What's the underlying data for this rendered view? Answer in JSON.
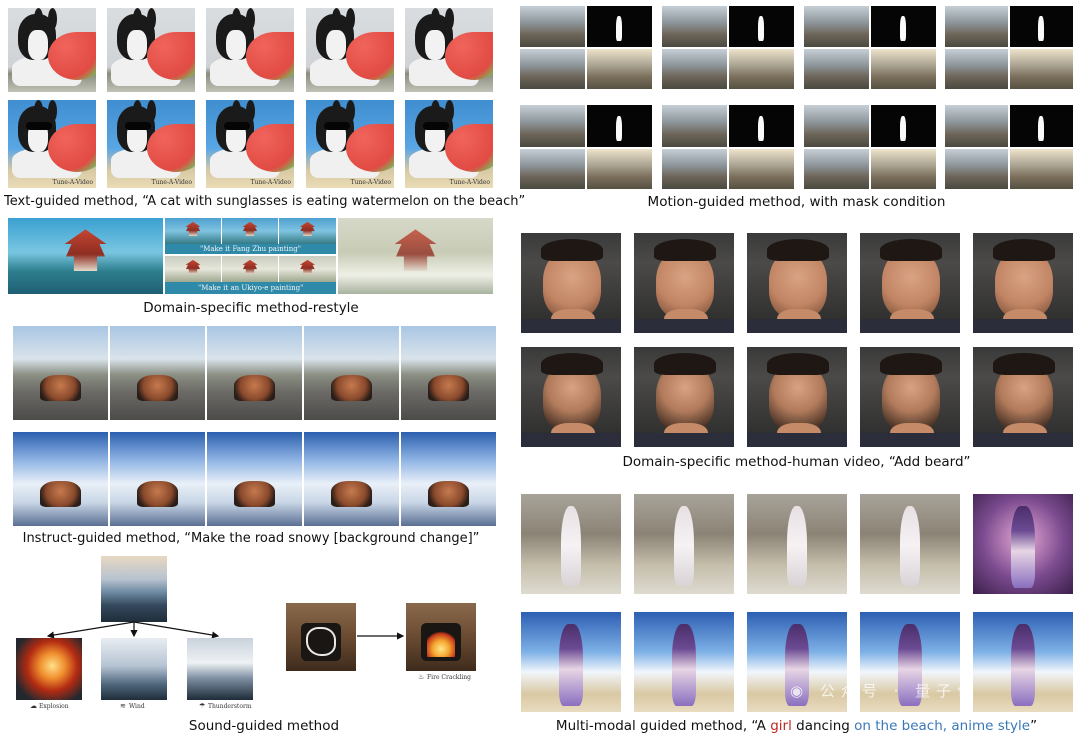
{
  "captions": {
    "text_guided": "Text-guided method, “A cat with sunglasses is eating watermelon on the beach”",
    "domain_restyle": "Domain-specific method-restyle",
    "instruct_guided": "Instruct-guided method, “Make the road snowy [background change]”",
    "sound_guided": "Sound-guided method",
    "motion_guided": "Motion-guided method, with mask condition",
    "human_video": "Domain-specific method-human video,  “Add beard”",
    "multimodal_prefix": "Multi-modal guided method, “A ",
    "multimodal_girl": "girl",
    "multimodal_mid": " dancing ",
    "multimodal_beach": "on the beach, anime style",
    "multimodal_suffix": "”"
  },
  "restyle": {
    "prompt_fang": "\"Make it Fang Zhu painting\"",
    "prompt_ukiyo": "\"Make it an Ukiyo-e painting\""
  },
  "sound": {
    "explosion": "Explosion",
    "wind": "Wind",
    "thunderstorm": "Thunderstorm",
    "fire": "Fire Crackling"
  },
  "watermark": "公众号 · 量子位",
  "frame_tag": "Tune-A-Video"
}
